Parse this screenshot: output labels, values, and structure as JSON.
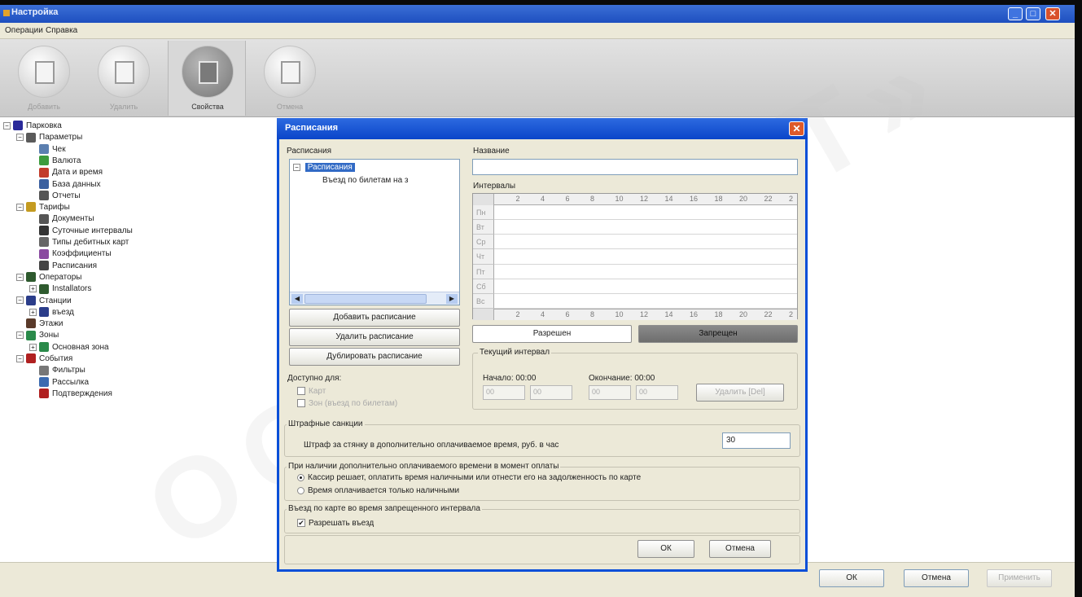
{
  "window": {
    "title": "Настройка"
  },
  "menu": [
    "Операции",
    "Справка"
  ],
  "toolbar": [
    {
      "label": "Добавить",
      "active": false
    },
    {
      "label": "Удалить",
      "active": false
    },
    {
      "label": "Свойства",
      "active": true
    },
    {
      "label": "Отмена",
      "active": false
    }
  ],
  "tree": [
    {
      "label": "Парковка",
      "level": 0,
      "exp": "−",
      "icon": "#2a2a9a",
      "icon_name": "parking-icon"
    },
    {
      "label": "Параметры",
      "level": 1,
      "exp": "−",
      "icon": "#5a5a5a",
      "icon_name": "gear-icon"
    },
    {
      "label": "Чек",
      "level": 2,
      "exp": "",
      "icon": "#5b7fb0",
      "icon_name": "receipt-icon"
    },
    {
      "label": "Валюта",
      "level": 2,
      "exp": "",
      "icon": "#3d9b3d",
      "icon_name": "currency-icon"
    },
    {
      "label": "Дата и время",
      "level": 2,
      "exp": "",
      "icon": "#c23b2a",
      "icon_name": "clock-icon"
    },
    {
      "label": "База данных",
      "level": 2,
      "exp": "",
      "icon": "#3a5f9f",
      "icon_name": "database-icon"
    },
    {
      "label": "Отчеты",
      "level": 2,
      "exp": "",
      "icon": "#555555",
      "icon_name": "report-icon"
    },
    {
      "label": "Тарифы",
      "level": 1,
      "exp": "−",
      "icon": "#c49b21",
      "icon_name": "tariff-icon"
    },
    {
      "label": "Документы",
      "level": 2,
      "exp": "",
      "icon": "#555555",
      "icon_name": "documents-icon"
    },
    {
      "label": "Суточные интервалы",
      "level": 2,
      "exp": "",
      "icon": "#333333",
      "icon_name": "interval-icon"
    },
    {
      "label": "Типы дебитных карт",
      "level": 2,
      "exp": "",
      "icon": "#666666",
      "icon_name": "card-icon"
    },
    {
      "label": "Коэффициенты",
      "level": 2,
      "exp": "",
      "icon": "#8a4aa0",
      "icon_name": "percent-icon"
    },
    {
      "label": "Расписания",
      "level": 2,
      "exp": "",
      "icon": "#444444",
      "icon_name": "schedule-icon"
    },
    {
      "label": "Операторы",
      "level": 1,
      "exp": "−",
      "icon": "#2e5a2e",
      "icon_name": "operators-icon"
    },
    {
      "label": "Installators",
      "level": 2,
      "exp": "+",
      "icon": "#2e5a2e",
      "icon_name": "installators-icon"
    },
    {
      "label": "Станции",
      "level": 1,
      "exp": "−",
      "icon": "#2b3d8a",
      "icon_name": "station-icon"
    },
    {
      "label": "въезд",
      "level": 2,
      "exp": "+",
      "icon": "#2b3d8a",
      "icon_name": "entry-icon"
    },
    {
      "label": "Этажи",
      "level": 1,
      "exp": "",
      "icon": "#5a3a2a",
      "icon_name": "floors-icon"
    },
    {
      "label": "Зоны",
      "level": 1,
      "exp": "−",
      "icon": "#2a8a4a",
      "icon_name": "zones-icon"
    },
    {
      "label": "Основная зона",
      "level": 2,
      "exp": "+",
      "icon": "#2a8a4a",
      "icon_name": "zone-icon"
    },
    {
      "label": "События",
      "level": 1,
      "exp": "−",
      "icon": "#b02020",
      "icon_name": "events-icon"
    },
    {
      "label": "Фильтры",
      "level": 2,
      "exp": "",
      "icon": "#777777",
      "icon_name": "filter-icon"
    },
    {
      "label": "Рассылка",
      "level": 2,
      "exp": "",
      "icon": "#3a6ab0",
      "icon_name": "mailing-icon"
    },
    {
      "label": "Подтверждения",
      "level": 2,
      "exp": "",
      "icon": "#b02020",
      "icon_name": "confirm-icon"
    }
  ],
  "dialog": {
    "title": "Расписания",
    "schedules_label": "Расписания",
    "schedule_root": "Расписания",
    "schedule_child": "Въезд по билетам на з",
    "name_label": "Название",
    "name_value": "",
    "intervals_label": "Интервалы",
    "hours": [
      "2",
      "4",
      "6",
      "8",
      "10",
      "12",
      "14",
      "16",
      "18",
      "20",
      "22",
      "2"
    ],
    "days": [
      "Пн",
      "Вт",
      "Ср",
      "Чт",
      "Пт",
      "Сб",
      "Вс"
    ],
    "allowed_button": "Разрешен",
    "forbidden_button": "Запрещен",
    "add_button": "Добавить расписание",
    "delete_button": "Удалить расписание",
    "duplicate_button": "Дублировать расписание",
    "available_for": "Доступно для:",
    "cards_label": "Карт",
    "zones_label": "Зон (въезд по билетам)",
    "current_interval": "Текущий интервал",
    "start_label": "Начало: 00:00",
    "end_label": "Окончание: 00:00",
    "spin_values": [
      "00",
      "00",
      "00",
      "00"
    ],
    "delete_interval": "Удалить [Del]",
    "penalty_group": "Штрафные санкции",
    "penalty_text": "Штраф за стянку в дополнительно оплачиваемое время, руб. в час",
    "penalty_value": "30",
    "payment_group": "При наличии дополнительно оплачиваемого времени в момент оплаты",
    "radio1": "Кассир решает, оплатить время наличными или отнести его на задолженность по карте",
    "radio2": "Время оплачивается только наличными",
    "entry_group": "Въезд по карте во время запрещенного интервала",
    "allow_entry": "Разрешать въезд",
    "ok": "ОК",
    "cancel": "Отмена"
  },
  "footer": {
    "ok": "ОК",
    "cancel": "Отмена",
    "apply": "Применить"
  },
  "watermark": "ООО «ПОКТ»"
}
